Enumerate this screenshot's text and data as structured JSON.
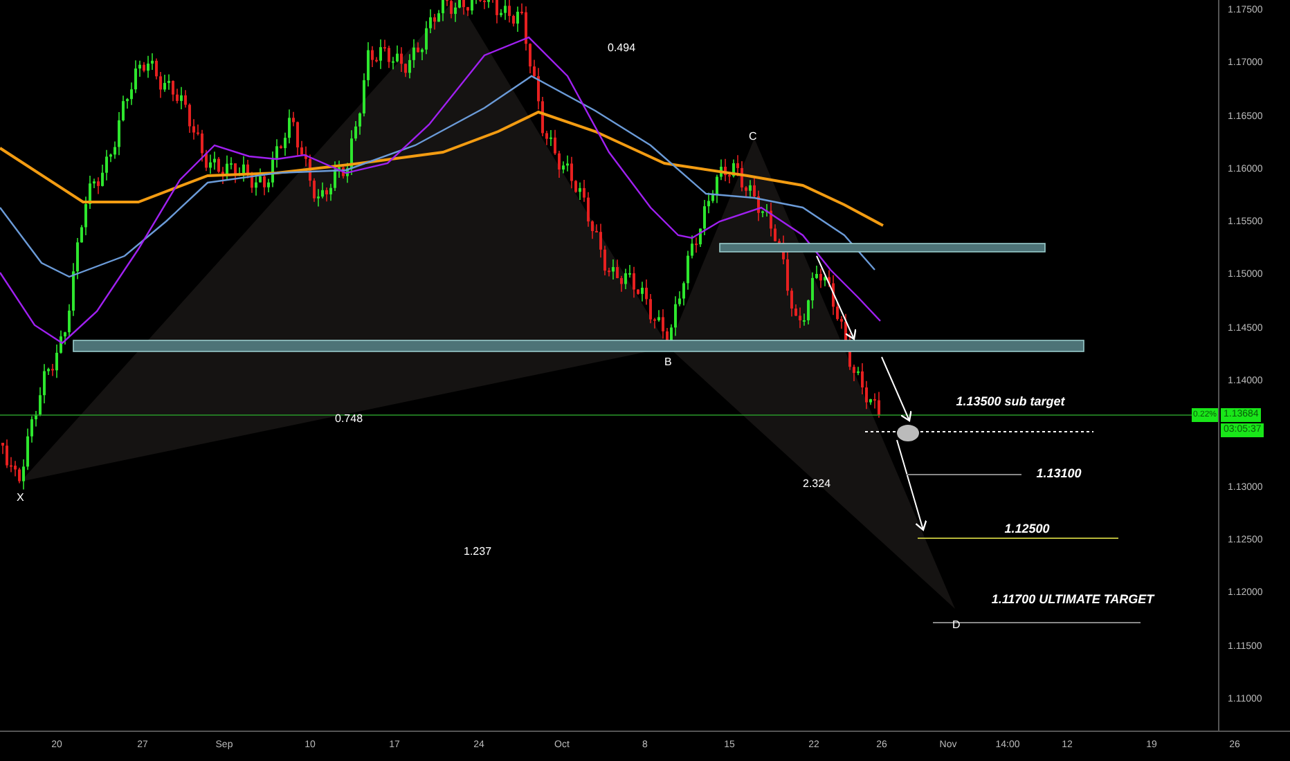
{
  "chart": {
    "price_axis": [
      "1.17500",
      "1.17000",
      "1.16500",
      "1.16000",
      "1.15500",
      "1.15000",
      "1.14500",
      "1.14000",
      "1.13000",
      "1.12500",
      "1.12000",
      "1.11500",
      "1.11000"
    ],
    "time_axis": [
      "20",
      "27",
      "Sep",
      "10",
      "17",
      "24",
      "Oct",
      "8",
      "15",
      "22",
      "26",
      "Nov",
      "14:00",
      "12",
      "19",
      "26"
    ],
    "last_price": {
      "change": "0.22%",
      "price": "1.13684",
      "countdown": "03:05:37"
    },
    "pattern_points": [
      "X",
      "B",
      "C",
      "D"
    ],
    "ratios": [
      "0.494",
      "0.748",
      "1.237",
      "2.324"
    ],
    "targets": [
      "1.13500 sub target",
      "1.13100",
      "1.12500",
      "1.11700 ULTIMATE TARGET"
    ]
  }
}
